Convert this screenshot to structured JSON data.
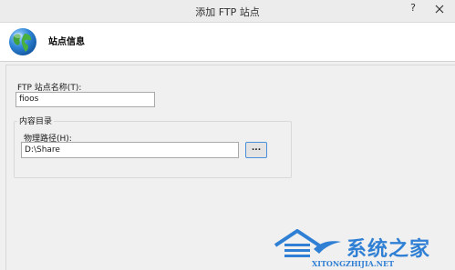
{
  "window": {
    "title": "添加 FTP 站点",
    "help_label": "?"
  },
  "header": {
    "title": "站点信息",
    "icon": "globe-icon"
  },
  "form": {
    "site_name_label": "FTP 站点名称(T):",
    "site_name_value": "fioos",
    "content_dir_legend": "内容目录",
    "physical_path_label": "物理路径(H):",
    "physical_path_value": "D:\\Share",
    "browse_label": "..."
  },
  "watermark": {
    "brand": "系统之家",
    "url": "XITONGZHIJIA.NET"
  },
  "colors": {
    "accent": "#2f7fd4",
    "header_bg": "#ffffff",
    "body_bg": "#f0f0f0"
  }
}
